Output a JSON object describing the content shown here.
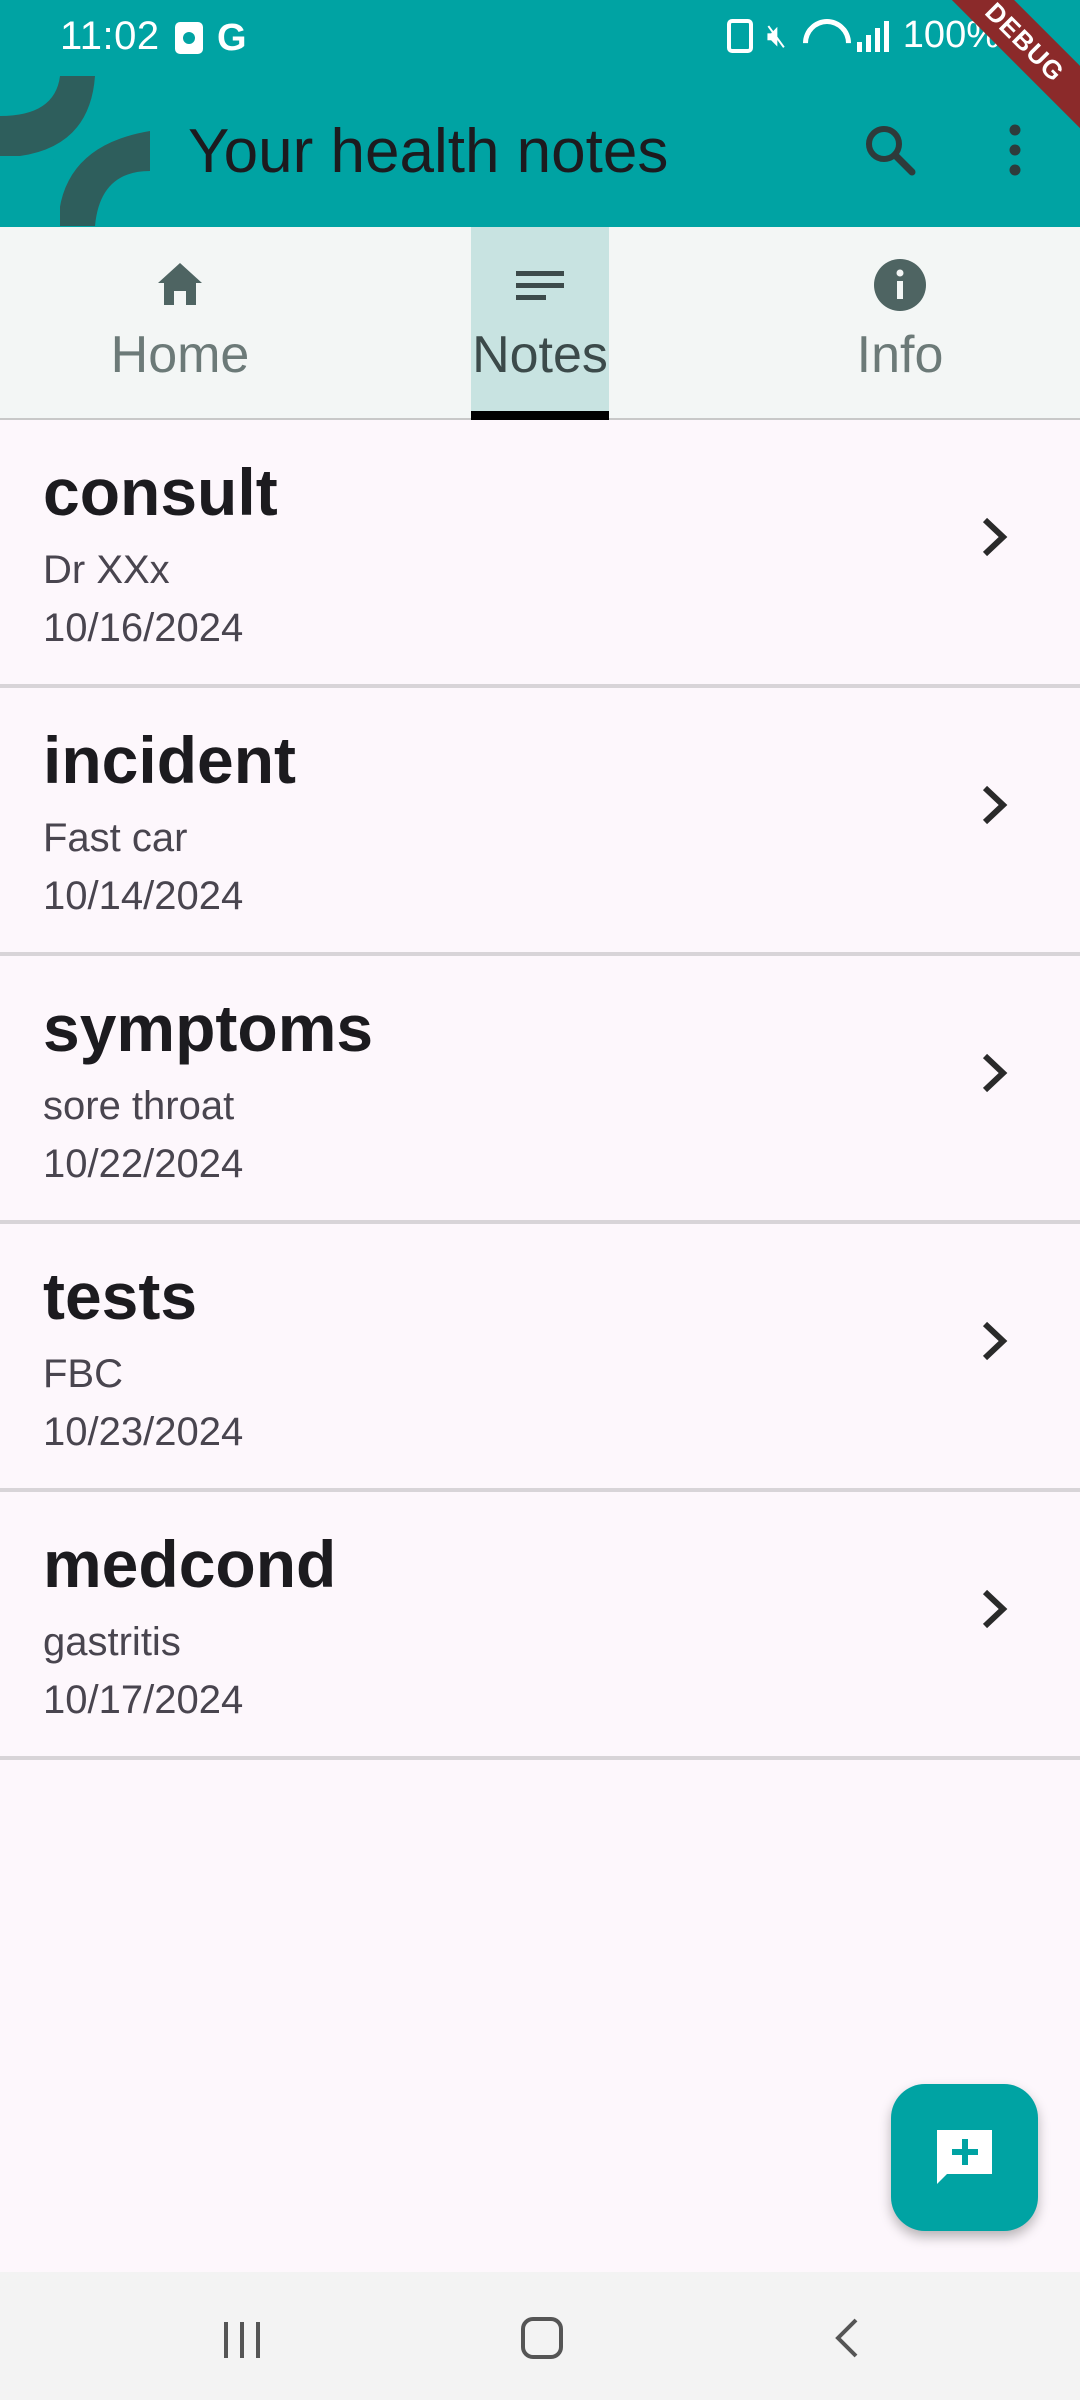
{
  "status_bar": {
    "time": "11:02",
    "g_glyph": "G",
    "battery": "100%",
    "debug_label": "DEBUG"
  },
  "app_bar": {
    "title": "Your health notes",
    "icons": [
      "app-logo-icon",
      "search-icon",
      "more-vert-icon"
    ]
  },
  "tabs": [
    {
      "label": "Home",
      "icon": "home-icon"
    },
    {
      "label": "Notes",
      "icon": "notes-icon",
      "selected": true
    },
    {
      "label": "Info",
      "icon": "info-icon"
    }
  ],
  "notes": [
    {
      "title": "consult",
      "subtitle": "Dr XXx",
      "date": "10/16/2024"
    },
    {
      "title": "incident",
      "subtitle": "Fast car",
      "date": "10/14/2024"
    },
    {
      "title": "symptoms",
      "subtitle": "sore throat",
      "date": "10/22/2024"
    },
    {
      "title": "tests",
      "subtitle": "FBC",
      "date": "10/23/2024"
    },
    {
      "title": "medcond",
      "subtitle": "gastritis",
      "date": "10/17/2024"
    }
  ],
  "fab": {
    "icon": "add-comment-icon"
  },
  "colors": {
    "primary": "#00A3A3",
    "background": "#FDF7FC",
    "tab_selected_bg": "#C8E3E1",
    "debug_ribbon": "#8B2A2A"
  }
}
